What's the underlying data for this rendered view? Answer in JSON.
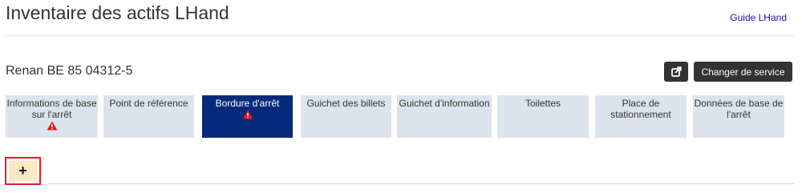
{
  "header": {
    "title": "Inventaire des actifs LHand",
    "guide_link": "Guide LHand"
  },
  "location": {
    "name": "Renan BE 85 04312-5",
    "export_icon": "external-link-icon",
    "change_service_label": "Changer de service"
  },
  "tabs": [
    {
      "line1": "Informations de base",
      "line2": "sur l'arrêt",
      "warning": true,
      "active": false
    },
    {
      "line1": "Point de référence",
      "line2": "",
      "warning": false,
      "active": false
    },
    {
      "line1": "Bordure d'arrêt",
      "line2": "",
      "warning": true,
      "active": true
    },
    {
      "line1": "Guichet des billets",
      "line2": "",
      "warning": false,
      "active": false
    },
    {
      "line1": "Guichet d'information",
      "line2": "",
      "warning": false,
      "active": false
    },
    {
      "line1": "Toilettes",
      "line2": "",
      "warning": false,
      "active": false
    },
    {
      "line1": "Place de",
      "line2": "stationnement",
      "warning": false,
      "active": false
    },
    {
      "line1": "Données de base de",
      "line2": "l'arrêt",
      "warning": false,
      "active": false
    }
  ],
  "add_button": {
    "label": "+"
  },
  "colors": {
    "active_tab": "#052a7c",
    "tab_bg": "#dde3ec",
    "warning": "#e01b1b",
    "add_bg": "#fde8c4",
    "highlight": "#e02020"
  }
}
